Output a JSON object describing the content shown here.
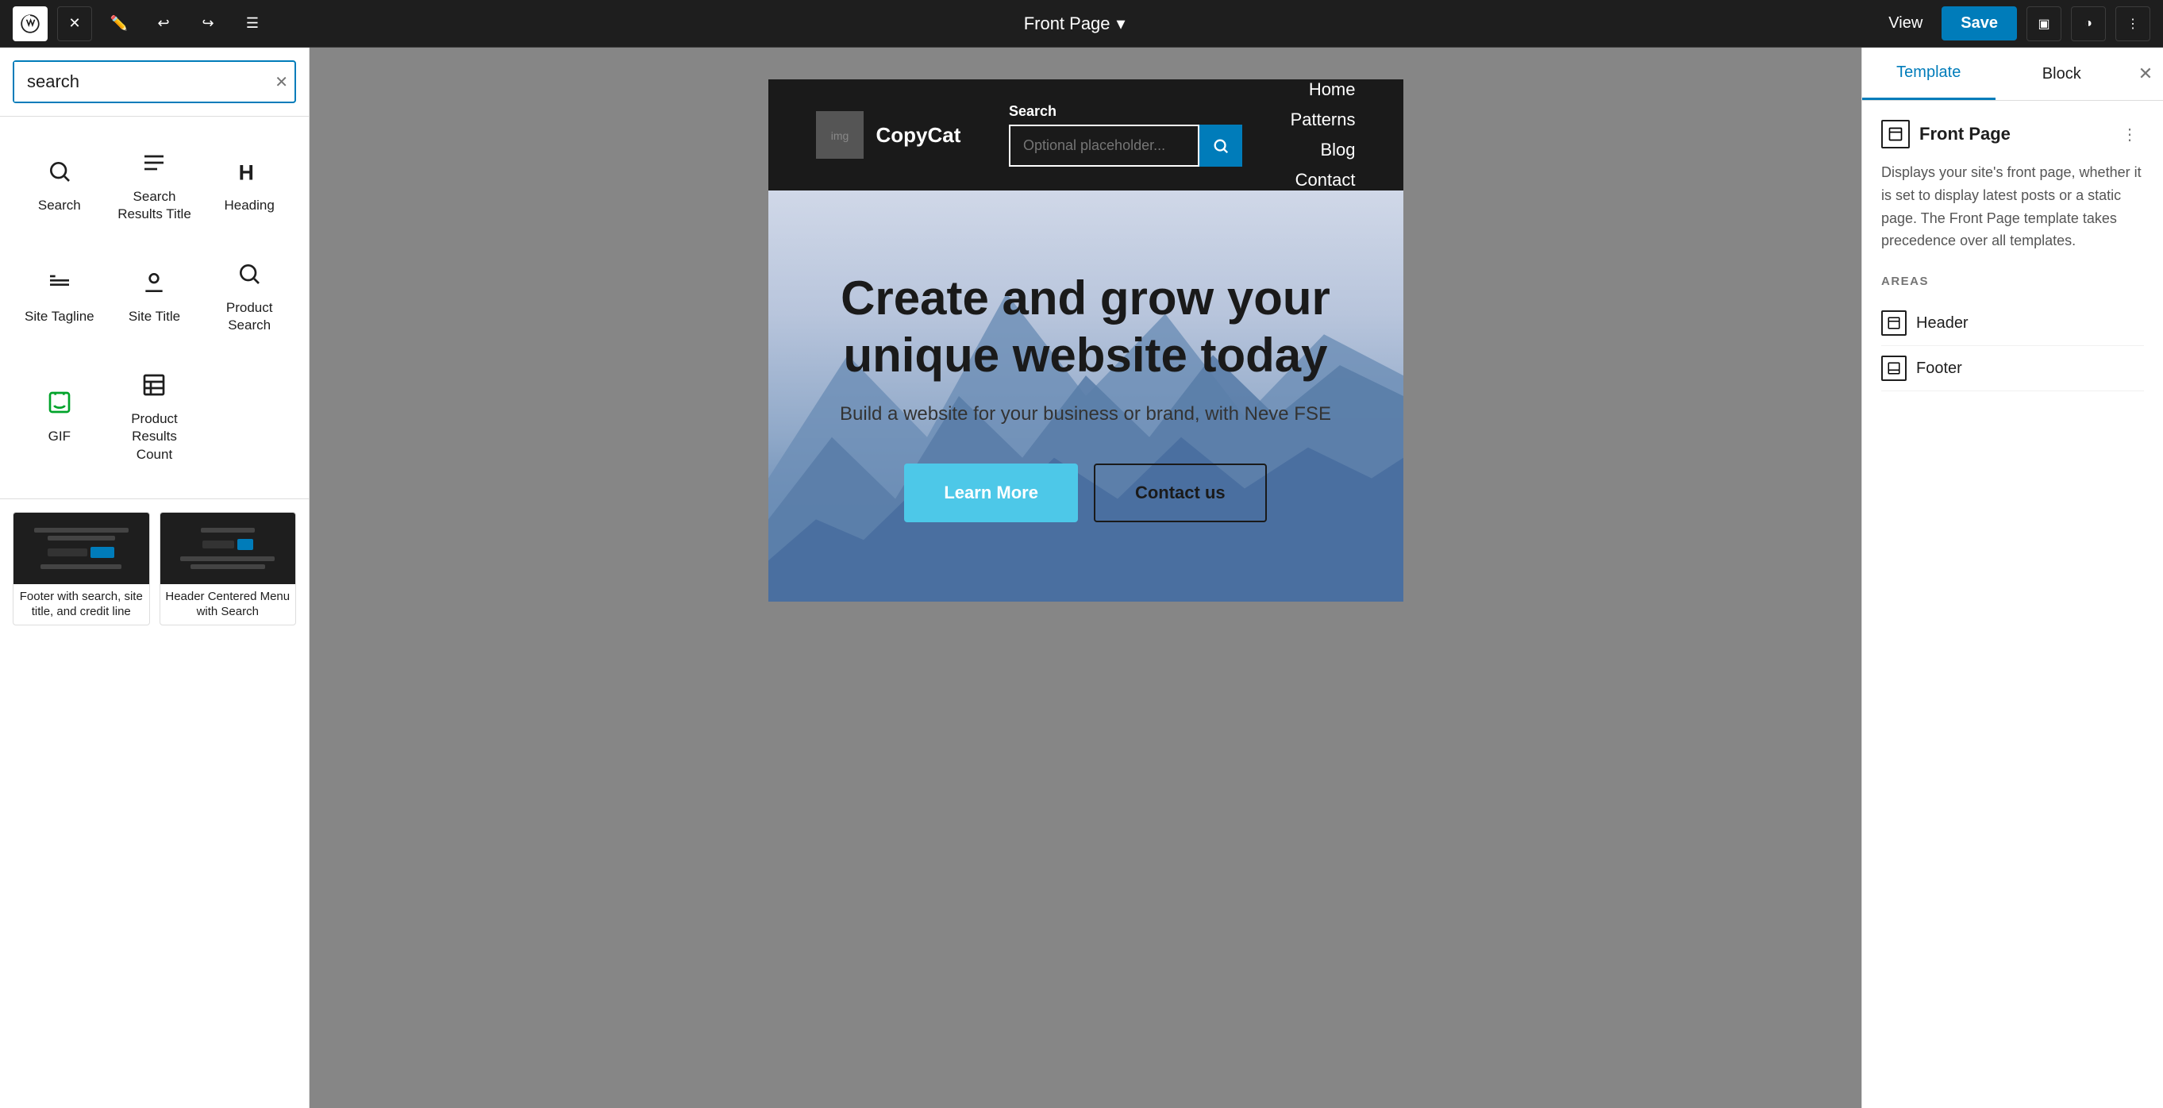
{
  "topbar": {
    "page_title": "Front Page",
    "view_label": "View",
    "save_label": "Save"
  },
  "left_panel": {
    "search_placeholder": "search",
    "blocks": [
      {
        "id": "search",
        "label": "Search",
        "icon": "search"
      },
      {
        "id": "search-results-title",
        "label": "Search Results Title",
        "icon": "search-results-title"
      },
      {
        "id": "heading",
        "label": "Heading",
        "icon": "heading"
      },
      {
        "id": "site-tagline",
        "label": "Site Tagline",
        "icon": "site-tagline"
      },
      {
        "id": "site-title",
        "label": "Site Title",
        "icon": "site-title"
      },
      {
        "id": "product-search",
        "label": "Product Search",
        "icon": "product-search"
      },
      {
        "id": "gif",
        "label": "GIF",
        "icon": "gif"
      },
      {
        "id": "product-results-count",
        "label": "Product Results Count",
        "icon": "product-results-count"
      }
    ],
    "patterns": [
      {
        "id": "footer-search",
        "label": "Footer with search, site title, and credit line"
      },
      {
        "id": "header-centered",
        "label": "Header Centered Menu with Search"
      }
    ]
  },
  "canvas": {
    "site_name": "CopyCat",
    "search_label": "Search",
    "search_placeholder": "Optional placeholder...",
    "nav_items": [
      "Home",
      "Patterns",
      "Blog",
      "Contact"
    ],
    "hero_title": "Create and grow your unique website today",
    "hero_subtitle": "Build a website for your business or brand, with Neve FSE",
    "btn_primary": "Learn More",
    "btn_secondary": "Contact us"
  },
  "right_panel": {
    "tab_template": "Template",
    "tab_block": "Block",
    "template_title": "Front Page",
    "template_desc": "Displays your site's front page, whether it is set to display latest posts or a static page. The Front Page template takes precedence over all templates.",
    "areas_label": "AREAS",
    "areas": [
      {
        "id": "header",
        "label": "Header"
      },
      {
        "id": "footer",
        "label": "Footer"
      }
    ]
  }
}
